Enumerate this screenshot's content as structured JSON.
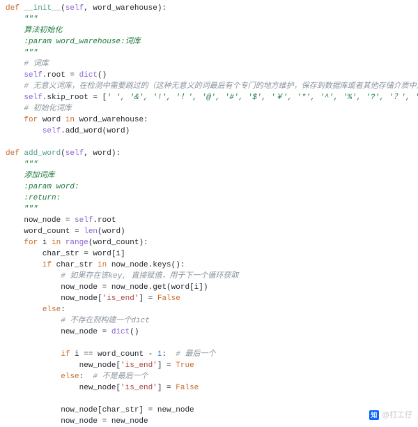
{
  "watermark": {
    "logo_text": "知",
    "author": "@打工仔"
  },
  "code": {
    "fn_init": {
      "sig_pre": "def ",
      "name": "__init__",
      "sig_post": "(",
      "param_self": "self",
      "sig_mid": ", word_warehouse):",
      "doc_open": "\"\"\"",
      "doc_l1": "算法初始化",
      "doc_l2": ":param word_warehouse:词库",
      "doc_close": "\"\"\"",
      "cmt_wordlib": "# 词库",
      "line_root_l": "self",
      "line_root_m": ".root = ",
      "line_root_r": "dict",
      "line_root_end": "()",
      "cmt_skip": "# 无意义词库，在检测中需要跳过的（这种无意义的词最后有个专门的地方维护，保存到数据库或者其他存储介质中）",
      "line_skip_l": "self",
      "line_skip_m": ".skip_root = [",
      "line_skip_str": "' ', '&', '!', '！', '@', '#', '$', '￥', '*', '^', '%', '?', '？', '<',",
      "cmt_init": "# 初始化词库",
      "for_kw": "for",
      "for_mid": " word ",
      "in_kw": "in",
      "for_tail": " word_warehouse:",
      "body_self": "self",
      "body_call": ".add_word(word)"
    },
    "fn_add": {
      "sig_pre": "def ",
      "name": "add_word",
      "sig_post": "(",
      "param_self": "self",
      "sig_mid": ", word):",
      "doc_open": "\"\"\"",
      "doc_l1": "添加词库",
      "doc_l2": ":param word:",
      "doc_l3": ":return:",
      "doc_close": "\"\"\"",
      "line_nn_l": "now_node = ",
      "line_nn_self": "self",
      "line_nn_r": ".root",
      "line_wc_l": "word_count = ",
      "line_wc_fn": "len",
      "line_wc_r": "(word)",
      "for_kw": "for",
      "for_mid": " i ",
      "in_kw": "in",
      "for_fn": " range",
      "for_tail": "(word_count):",
      "line_cs": "char_str = word[i]",
      "if_kw": "if",
      "if_mid": " char_str ",
      "if_in": "in",
      "if_tail": " now_node.keys():",
      "cmt_hit": "# 如果存在该key, 直接赋值，用于下一个循环获取",
      "line_get": "now_node = now_node.get(word[i])",
      "line_set_false_l": "now_node[",
      "line_set_false_key": "'is_end'",
      "line_set_false_mid": "] = ",
      "line_set_false_val": "False",
      "else_kw": "else",
      "else_colon": ":",
      "cmt_miss": "# 不存在则构建一个dict",
      "line_newdict_l": "new_node = ",
      "line_newdict_fn": "dict",
      "line_newdict_r": "()",
      "if2_kw": "if",
      "if2_mid": " i == word_count - ",
      "if2_num": "1",
      "if2_colon": ":  ",
      "cmt_last": "# 最后一个",
      "line_true_l": "new_node[",
      "line_true_key": "'is_end'",
      "line_true_mid": "] = ",
      "line_true_val": "True",
      "else2_kw": "else",
      "else2_colon": ":  ",
      "cmt_notlast": "# 不是最后一个",
      "line_false2_l": "new_node[",
      "line_false2_key": "'is_end'",
      "line_false2_mid": "] = ",
      "line_false2_val": "False",
      "line_assign1": "now_node[char_str] = new_node",
      "line_assign2": "now_node = new_node"
    }
  }
}
